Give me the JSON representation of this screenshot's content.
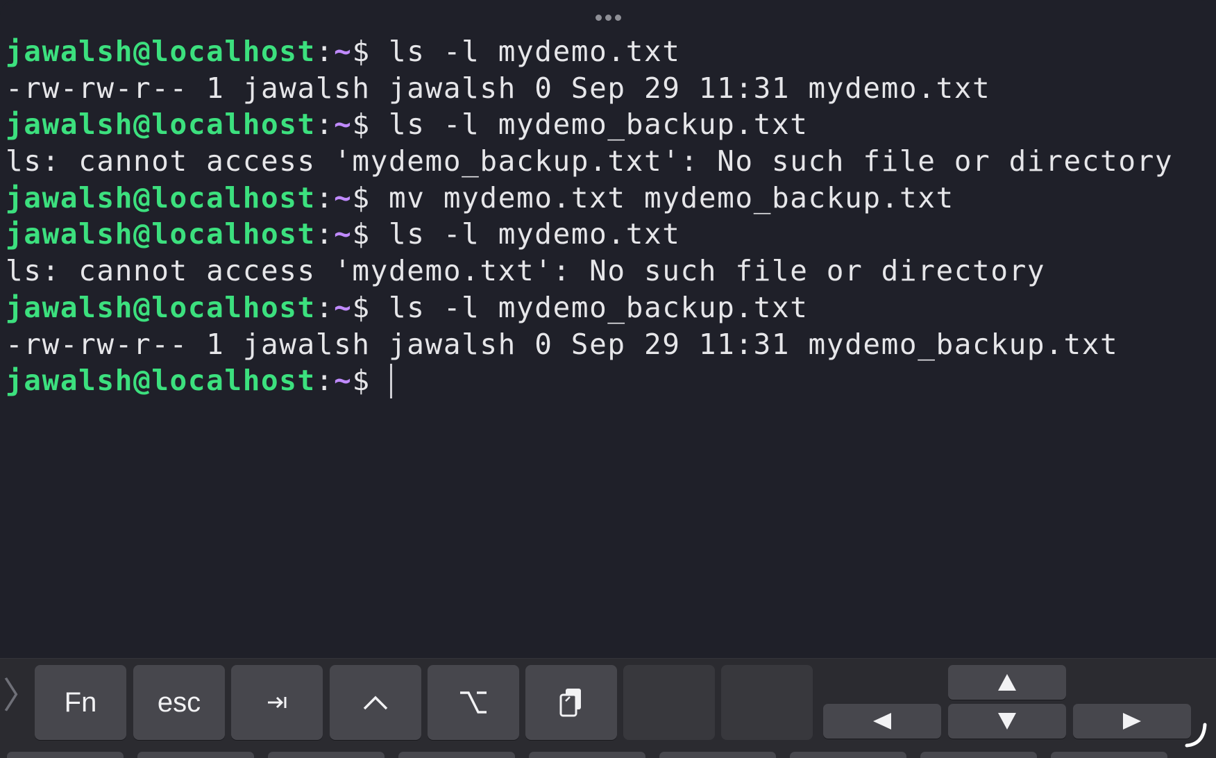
{
  "terminal": {
    "prompt": {
      "user_host": "jawalsh@localhost",
      "separator": ":",
      "path": "~",
      "symbol": "$ "
    },
    "lines": [
      {
        "type": "prompt",
        "command": "ls -l mydemo.txt"
      },
      {
        "type": "output",
        "text": "-rw-rw-r-- 1 jawalsh jawalsh 0 Sep 29 11:31 mydemo.txt"
      },
      {
        "type": "prompt",
        "command": "ls -l mydemo_backup.txt"
      },
      {
        "type": "output",
        "text": "ls: cannot access 'mydemo_backup.txt': No such file or directory"
      },
      {
        "type": "prompt",
        "command": "mv mydemo.txt mydemo_backup.txt"
      },
      {
        "type": "prompt",
        "command": "ls -l mydemo.txt"
      },
      {
        "type": "output",
        "text": "ls: cannot access 'mydemo.txt': No such file or directory"
      },
      {
        "type": "prompt",
        "command": "ls -l mydemo_backup.txt"
      },
      {
        "type": "output",
        "text": "-rw-rw-r-- 1 jawalsh jawalsh 0 Sep 29 11:31 mydemo_backup.txt"
      },
      {
        "type": "prompt",
        "command": ""
      }
    ],
    "colors": {
      "background": "#1f2029",
      "user_host": "#3ce07e",
      "path": "#c08aff",
      "text": "#e6e6e9"
    }
  },
  "keyboard_bar": {
    "keys": [
      {
        "name": "fn-key",
        "label": "Fn"
      },
      {
        "name": "esc-key",
        "label": "esc"
      },
      {
        "name": "tab-key",
        "icon": "tab-icon"
      },
      {
        "name": "ctrl-key",
        "icon": "control-icon"
      },
      {
        "name": "option-key",
        "icon": "option-icon"
      },
      {
        "name": "paste-key",
        "icon": "clipboard-icon"
      }
    ],
    "arrows": [
      "arrow-up-icon",
      "arrow-left-icon",
      "arrow-down-icon",
      "arrow-right-icon"
    ]
  }
}
